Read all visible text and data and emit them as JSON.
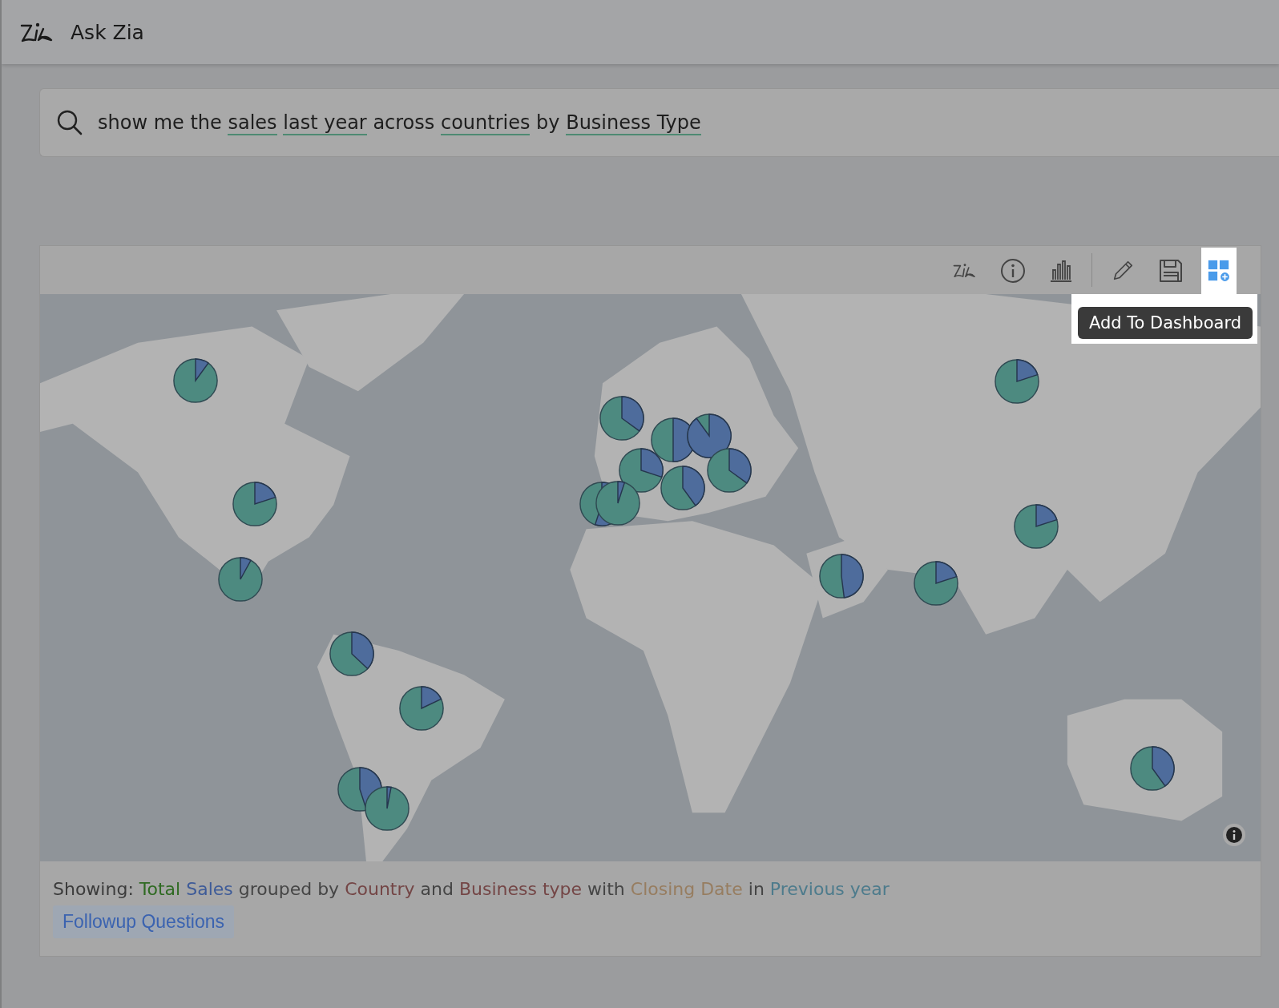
{
  "app": {
    "title": "Ask Zia"
  },
  "search": {
    "query": [
      {
        "text": "show me the",
        "underlined": false
      },
      {
        "text": "sales",
        "underlined": true
      },
      {
        "text": "last year",
        "underlined": true
      },
      {
        "text": "across",
        "underlined": false
      },
      {
        "text": "countries",
        "underlined": true
      },
      {
        "text": "by",
        "underlined": false
      },
      {
        "text": "Business Type",
        "underlined": true
      }
    ]
  },
  "toolbar": {
    "buttons": [
      {
        "kind": "zia",
        "highlighted": false
      },
      {
        "kind": "info",
        "highlighted": false
      },
      {
        "kind": "chart",
        "highlighted": false
      },
      {
        "kind": "edit",
        "highlighted": false
      },
      {
        "kind": "save",
        "highlighted": false
      },
      {
        "kind": "dashboard",
        "highlighted": true
      }
    ],
    "tooltip": "Add To Dashboard"
  },
  "summary": {
    "segments": [
      {
        "text": "Showing: ",
        "color": "#3b3b3b"
      },
      {
        "text": "Total",
        "color": "#2f6a22"
      },
      {
        "text": "Sales",
        "color": "#3e5b98"
      },
      {
        "text": "grouped by",
        "color": "#454545"
      },
      {
        "text": "Country",
        "color": "#744646"
      },
      {
        "text": "and",
        "color": "#454545"
      },
      {
        "text": "Business type",
        "color": "#744646"
      },
      {
        "text": "with",
        "color": "#454545"
      },
      {
        "text": "Closing Date",
        "color": "#977d60"
      },
      {
        "text": "in",
        "color": "#454545"
      },
      {
        "text": "Previous year",
        "color": "#4d7b8c"
      }
    ],
    "followup_button": "Followup Questions"
  }
}
